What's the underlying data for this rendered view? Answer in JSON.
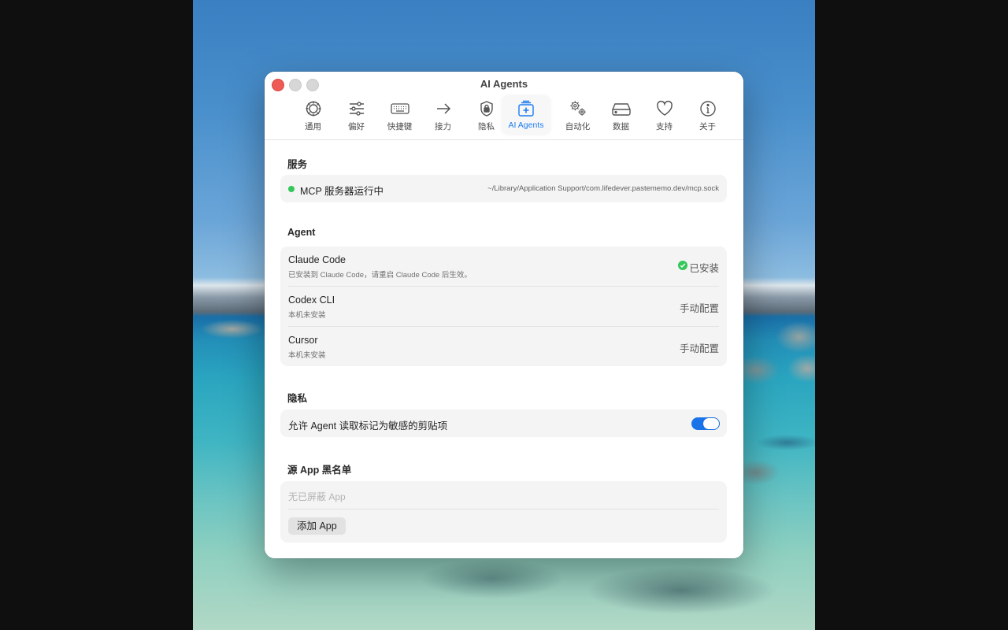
{
  "window": {
    "title": "AI Agents"
  },
  "tabs": [
    {
      "label": "通用",
      "icon": "general-icon"
    },
    {
      "label": "偏好",
      "icon": "sliders-icon"
    },
    {
      "label": "快捷键",
      "icon": "keyboard-icon"
    },
    {
      "label": "接力",
      "icon": "arrow-right-icon"
    },
    {
      "label": "隐私",
      "icon": "lock-shield-icon"
    },
    {
      "label": "AI Agents",
      "icon": "ai-agents-icon",
      "active": true
    },
    {
      "label": "自动化",
      "icon": "gears-icon"
    },
    {
      "label": "数据",
      "icon": "drive-icon"
    },
    {
      "label": "支持",
      "icon": "heart-icon"
    },
    {
      "label": "关于",
      "icon": "info-icon"
    }
  ],
  "service": {
    "title": "服务",
    "status": "MCP 服务器运行中",
    "path": "~/Library/Application Support/com.lifedever.pastememo.dev/mcp.sock"
  },
  "agent": {
    "title": "Agent",
    "items": [
      {
        "name": "Claude Code",
        "desc": "已安装到 Claude Code，请重启 Claude Code 后生效。",
        "status": "已安装"
      },
      {
        "name": "Codex CLI",
        "desc": "本机未安装",
        "status": "手动配置"
      },
      {
        "name": "Cursor",
        "desc": "本机未安装",
        "status": "手动配置"
      }
    ]
  },
  "privacy": {
    "title": "隐私",
    "label": "允许 Agent 读取标记为敏感的剪贴项",
    "enabled": true
  },
  "blacklist": {
    "title": "源 App 黑名单",
    "empty_text": "无已屏蔽 App",
    "add_label": "添加 App"
  },
  "colors": {
    "accent": "#1b7cf0",
    "success": "#34c759",
    "toggle_on": "#1a73e8"
  }
}
